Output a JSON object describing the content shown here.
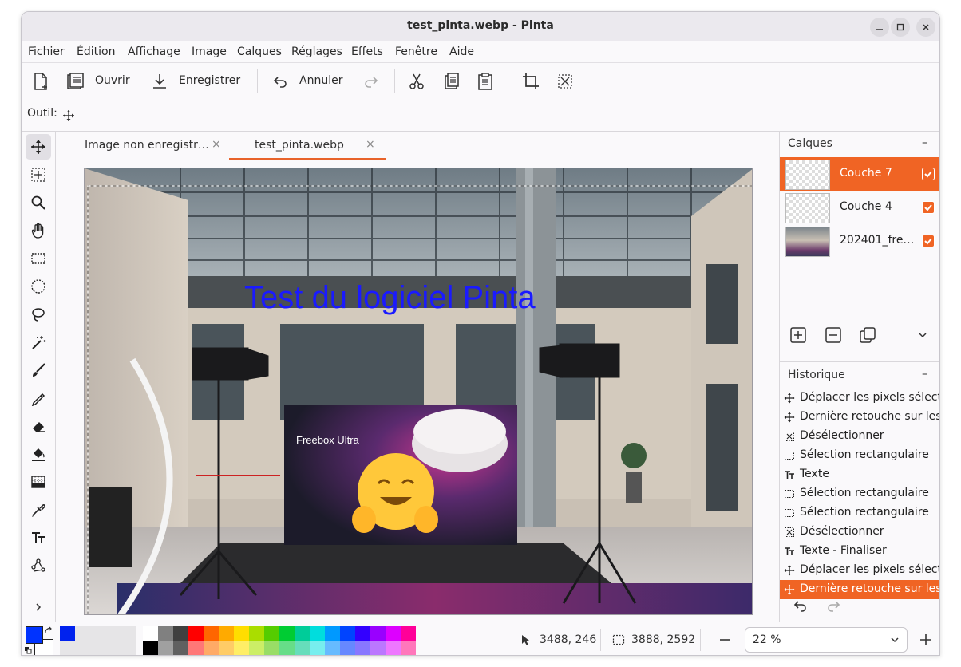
{
  "window": {
    "title": "test_pinta.webp - Pinta"
  },
  "menu": [
    "Fichier",
    "Édition",
    "Affichage",
    "Image",
    "Calques",
    "Réglages",
    "Effets",
    "Fenêtre",
    "Aide"
  ],
  "toolbar": {
    "open_label": "Ouvrir",
    "save_label": "Enregistrer",
    "undo_label": "Annuler"
  },
  "tool_options": {
    "label": "Outil:"
  },
  "tabs": [
    {
      "label": "Image non enregistr…",
      "active": false
    },
    {
      "label": "test_pinta.webp",
      "active": true
    }
  ],
  "canvas": {
    "overlay_text": "Test du logiciel Pinta",
    "overlay_color": "#1a1aff"
  },
  "layers_panel": {
    "title": "Calques",
    "layers": [
      {
        "name": "Couche 7",
        "selected": true,
        "visible": true
      },
      {
        "name": "Couche 4",
        "selected": false,
        "visible": true
      },
      {
        "name": "202401_fre…",
        "selected": false,
        "visible": true
      }
    ]
  },
  "history_panel": {
    "title": "Historique",
    "items": [
      {
        "icon": "move-icon",
        "label": "Déplacer les pixels sélectionnés"
      },
      {
        "icon": "move-icon",
        "label": "Dernière retouche sur les pixels"
      },
      {
        "icon": "deselect-icon",
        "label": "Désélectionner"
      },
      {
        "icon": "rect-select-icon",
        "label": "Sélection rectangulaire"
      },
      {
        "icon": "text-icon",
        "label": "Texte"
      },
      {
        "icon": "rect-select-icon",
        "label": "Sélection rectangulaire"
      },
      {
        "icon": "rect-select-icon",
        "label": "Sélection rectangulaire"
      },
      {
        "icon": "deselect-icon",
        "label": "Désélectionner"
      },
      {
        "icon": "text-icon",
        "label": "Texte - Finaliser"
      },
      {
        "icon": "move-icon",
        "label": "Déplacer les pixels sélectionnés"
      },
      {
        "icon": "move-icon",
        "label": "Dernière retouche sur les pixels"
      }
    ],
    "selected_index": 10
  },
  "status": {
    "cursor_position": "3488, 246",
    "selection_size": "3888, 2592",
    "zoom": "22 %"
  },
  "palette": {
    "primary": "#0033ff",
    "secondary": "#ffffff",
    "recent": [
      "#0022ee"
    ],
    "top_row": [
      "#ffffff",
      "#808080",
      "#404040",
      "#ff0000",
      "#ff6600",
      "#ffaa00",
      "#ffdd00",
      "#aadd00",
      "#55cc00",
      "#00cc33",
      "#00cc99",
      "#00dddd",
      "#0099ff",
      "#0044ff",
      "#3300ff",
      "#9900ff",
      "#dd00ff",
      "#ff0099"
    ],
    "bottom_row": [
      "#000000",
      "#a0a0a0",
      "#606060",
      "#ff7777",
      "#ffaa66",
      "#ffcc66",
      "#ffee66",
      "#ccee66",
      "#99dd66",
      "#66dd88",
      "#66ddbb",
      "#77eeee",
      "#66bbff",
      "#6688ff",
      "#8877ff",
      "#bb77ff",
      "#ee77ff",
      "#ff77bb"
    ]
  }
}
